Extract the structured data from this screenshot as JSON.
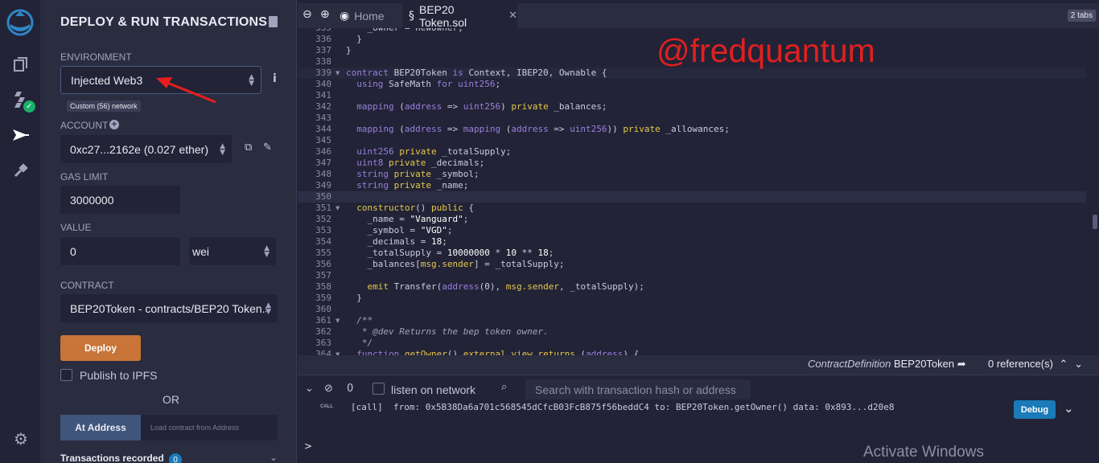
{
  "icons": {
    "logo": "remix-logo-icon",
    "files": "file-explorer-icon",
    "compiler": "solidity-compiler-icon",
    "deploy": "deploy-run-icon",
    "plugins": "plugin-manager-icon",
    "settings": "gear-icon",
    "compiler_badge": "✓"
  },
  "panel": {
    "title": "DEPLOY & RUN TRANSACTIONS",
    "environment_label": "ENVIRONMENT",
    "environment_value": "Injected Web3",
    "network_tooltip": "Custom (56) network",
    "account_label": "ACCOUNT",
    "account_value": "0xc27...2162e (0.027 ether)",
    "gas_limit_label": "GAS LIMIT",
    "gas_limit_value": "3000000",
    "value_label": "VALUE",
    "value_value": "0",
    "value_unit": "wei",
    "contract_label": "CONTRACT",
    "contract_value": "BEP20Token - contracts/BEP20 Token.sol",
    "deploy_button": "Deploy",
    "publish_ipfs": "Publish to IPFS",
    "or_text": "OR",
    "at_address_button": "At Address",
    "at_address_placeholder": "Load contract from Address",
    "transactions_recorded": "Transactions recorded",
    "transactions_count": "0"
  },
  "tabs": {
    "home": "Home",
    "file": "BEP20 Token.sol",
    "count_badge": "2 tabs"
  },
  "editor": {
    "lines": [
      {
        "n": "335",
        "fold": false,
        "html": "    _owner = newOwner;"
      },
      {
        "n": "336",
        "fold": false,
        "html": "  }"
      },
      {
        "n": "337",
        "fold": false,
        "html": "}"
      },
      {
        "n": "338",
        "fold": false,
        "html": ""
      },
      {
        "n": "339",
        "fold": true,
        "html": "<span class=\"kw\">contract</span> BEP20Token <span class=\"kw\">is</span> Context, IBEP20, Ownable {"
      },
      {
        "n": "340",
        "fold": false,
        "html": "  <span class=\"kw\">using</span> SafeMath <span class=\"kw\">for</span> <span class=\"ty\">uint256</span>;"
      },
      {
        "n": "341",
        "fold": false,
        "html": ""
      },
      {
        "n": "342",
        "fold": false,
        "html": "  <span class=\"ty\">mapping</span> (<span class=\"ty\">address</span> =&gt; <span class=\"ty\">uint256</span>) <span class=\"pv\">private</span> _balances;"
      },
      {
        "n": "343",
        "fold": false,
        "html": ""
      },
      {
        "n": "344",
        "fold": false,
        "html": "  <span class=\"ty\">mapping</span> (<span class=\"ty\">address</span> =&gt; <span class=\"ty\">mapping</span> (<span class=\"ty\">address</span> =&gt; <span class=\"ty\">uint256</span>)) <span class=\"pv\">private</span> _allowances;"
      },
      {
        "n": "345",
        "fold": false,
        "html": ""
      },
      {
        "n": "346",
        "fold": false,
        "html": "  <span class=\"ty\">uint256</span> <span class=\"pv\">private</span> _totalSupply;"
      },
      {
        "n": "347",
        "fold": false,
        "html": "  <span class=\"ty\">uint8</span> <span class=\"pv\">private</span> _decimals;"
      },
      {
        "n": "348",
        "fold": false,
        "html": "  <span class=\"ty\">string</span> <span class=\"pv\">private</span> _symbol;"
      },
      {
        "n": "349",
        "fold": false,
        "html": "  <span class=\"ty\">string</span> <span class=\"pv\">private</span> _name;"
      },
      {
        "n": "350",
        "fold": false,
        "html": ""
      },
      {
        "n": "351",
        "fold": true,
        "html": "  <span class=\"pv\">constructor</span>() <span class=\"pv\">public</span> {"
      },
      {
        "n": "352",
        "fold": false,
        "html": "    _name = <span class=\"st\">\"Vanguard\"</span>;"
      },
      {
        "n": "353",
        "fold": false,
        "html": "    _symbol = <span class=\"st\">\"VGD\"</span>;"
      },
      {
        "n": "354",
        "fold": false,
        "html": "    _decimals = <span class=\"st\">18</span>;"
      },
      {
        "n": "355",
        "fold": false,
        "html": "    _totalSupply = <span class=\"st\">10000000</span> * <span class=\"st\">10</span> ** <span class=\"st\">18</span>;"
      },
      {
        "n": "356",
        "fold": false,
        "html": "    _balances[<span class=\"pv\">msg.sender</span>] = _totalSupply;"
      },
      {
        "n": "357",
        "fold": false,
        "html": ""
      },
      {
        "n": "358",
        "fold": false,
        "html": "    <span class=\"pv\">emit</span> Transfer(<span class=\"ty\">address</span>(0), <span class=\"pv\">msg.sender</span>, _totalSupply);"
      },
      {
        "n": "359",
        "fold": false,
        "html": "  }"
      },
      {
        "n": "360",
        "fold": false,
        "html": ""
      },
      {
        "n": "361",
        "fold": true,
        "html": "  <span class=\"cm\">/**</span>"
      },
      {
        "n": "362",
        "fold": false,
        "html": "   <span class=\"cm\">* @dev Returns the bep token owner.</span>"
      },
      {
        "n": "363",
        "fold": false,
        "html": "   <span class=\"cm\">*/</span>"
      },
      {
        "n": "364",
        "fold": true,
        "html": "  <span class=\"kw\">function</span> <span class=\"pv\">getOwner</span>() <span class=\"pv\">external</span> <span class=\"pv\">view</span> <span class=\"pv\">returns</span> (<span class=\"ty\">address</span>) {"
      }
    ]
  },
  "watermark": "@fredquantum",
  "status": {
    "definition_kind": "ContractDefinition",
    "definition_name": "BEP20Token",
    "references": "0 reference(s)"
  },
  "terminal": {
    "count": "0",
    "listen_label": "listen on network",
    "search_placeholder": "Search with transaction hash or address",
    "call_tag": "CALL",
    "call_text": "[call]  from: 0x5B38Da6a701c568545dCfcB03FcB875f56beddC4 to: BEP20Token.getOwner() data: 0x893...d20e8",
    "debug_button": "Debug",
    "prompt": ">"
  },
  "os_overlay": "Activate Windows",
  "colors": {
    "panel_bg": "#2a2c3f",
    "editor_bg": "#222336",
    "deploy_orange": "#c97539",
    "debug_blue": "#1a7bb8",
    "watermark_red": "#e02020"
  }
}
